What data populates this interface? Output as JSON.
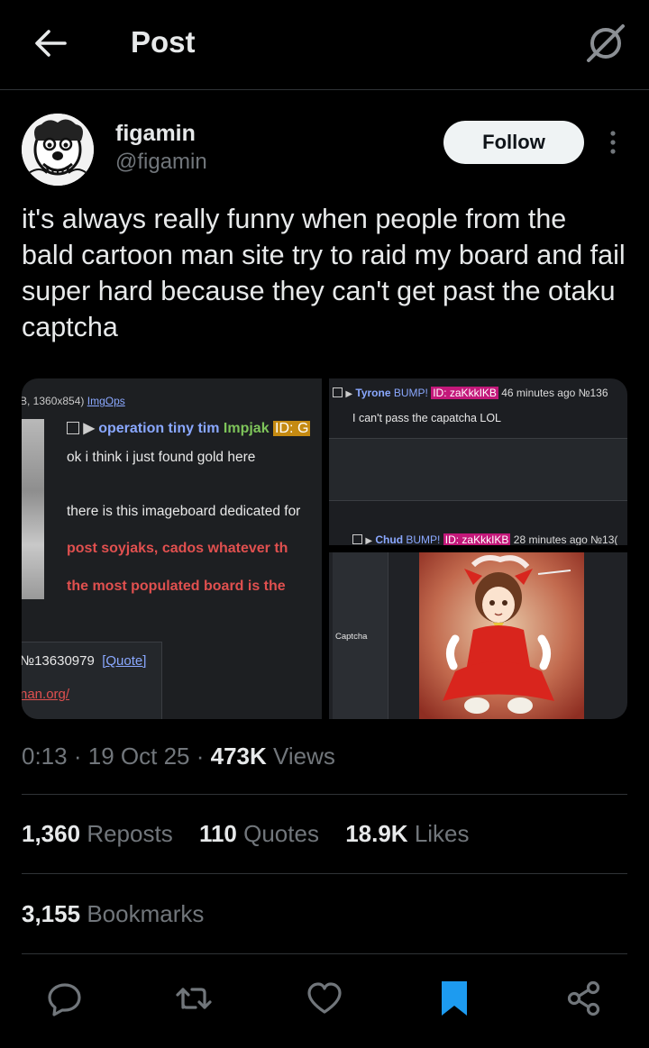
{
  "header": {
    "title": "Post",
    "back_icon": "arrow-left-icon",
    "grok_icon": "grok-icon"
  },
  "author": {
    "display_name": "figamin",
    "handle": "@figamin",
    "follow_label": "Follow"
  },
  "post": {
    "text": "it's always really funny when people from the bald cartoon man site try to raid my board and fail super hard because they can't get past the otaku captcha"
  },
  "media": {
    "left": {
      "file_info": "B, 1360x854)",
      "imgops": "ImgOps",
      "name": "operation tiny tim",
      "name2": "Impjak",
      "id_badge": "ID: G",
      "line1": "ok i think i just found gold here",
      "line2": "there is this imageboard dedicated for",
      "red1": "post soyjaks, cados whatever th",
      "red2": "the most populated board is the",
      "post_no": "№13630979",
      "quote": "[Quote]",
      "link": "nan.org/"
    },
    "right_top": {
      "name": "Tyrone",
      "bump": "BUMP!",
      "id_badge": "ID: zaKkkIKB",
      "time": "46 minutes ago №136",
      "message": "I can't pass the capatcha LOL",
      "name2": "Chud",
      "bump2": "BUMP!",
      "id_badge2": "ID: zaKkkIKB",
      "time2": "28 minutes ago №13("
    },
    "right_bottom": {
      "captcha_label": "Captcha"
    }
  },
  "meta": {
    "time": "0:13",
    "date": "19 Oct 25",
    "views_count": "473K",
    "views_label": "Views",
    "sep": "·"
  },
  "stats": {
    "reposts_count": "1,360",
    "reposts_label": "Reposts",
    "quotes_count": "110",
    "quotes_label": "Quotes",
    "likes_count": "18.9K",
    "likes_label": "Likes",
    "bookmarks_count": "3,155",
    "bookmarks_label": "Bookmarks"
  },
  "actions": [
    "reply-icon",
    "repost-icon",
    "like-icon",
    "bookmark-icon",
    "share-icon"
  ],
  "colors": {
    "accent": "#1d9bf0",
    "muted": "#71767b",
    "text": "#e7e9ea",
    "id_badge": "#c3187a",
    "ib_red": "#e0504f",
    "ib_green": "#7ec45a",
    "ib_blue": "#8aa8ff"
  }
}
